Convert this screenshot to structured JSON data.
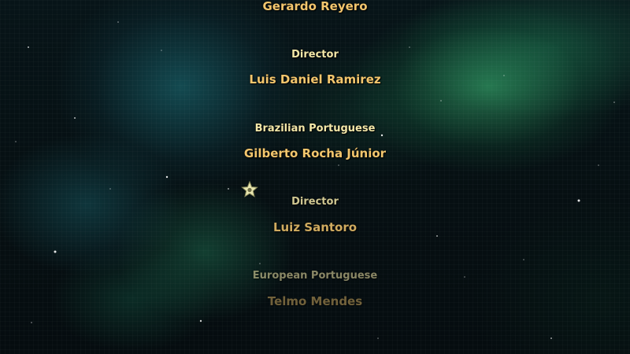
{
  "credits": [
    {
      "kind": "name",
      "text": "Gerardo Reyero"
    },
    {
      "kind": "role",
      "text": "Director"
    },
    {
      "kind": "name",
      "text": "Luis Daniel Ramirez"
    },
    {
      "kind": "role",
      "text": "Brazilian Portuguese"
    },
    {
      "kind": "name",
      "text": "Gilberto Rocha Júnior"
    },
    {
      "kind": "role",
      "text": "Director"
    },
    {
      "kind": "name",
      "text": "Luiz Santoro"
    },
    {
      "kind": "role",
      "text": "European Portuguese"
    },
    {
      "kind": "name",
      "text": "Telmo Mendes"
    }
  ],
  "colors": {
    "role_text": "#f3e7a8",
    "name_text": "#f3c66d",
    "nebula_green": "#3cbe78",
    "nebula_teal": "#1e7882"
  },
  "icons": {
    "cursor": "star-cursor-icon"
  }
}
